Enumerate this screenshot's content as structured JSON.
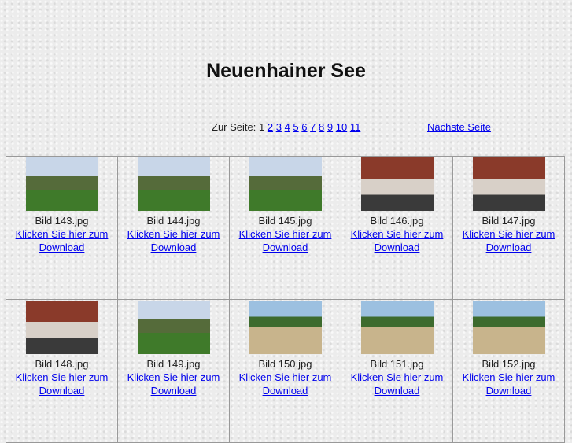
{
  "title": "Neuenhainer See",
  "pager": {
    "label": "Zur Seite:",
    "current": "1",
    "pages": [
      "2",
      "3",
      "4",
      "5",
      "6",
      "7",
      "8",
      "9",
      "10",
      "11"
    ],
    "next": "Nächste Seite"
  },
  "rows": [
    [
      {
        "name": "Bild 143.jpg",
        "type": "out"
      },
      {
        "name": "Bild 144.jpg",
        "type": "out"
      },
      {
        "name": "Bild 145.jpg",
        "type": "out"
      },
      {
        "name": "Bild 146.jpg",
        "type": "in"
      },
      {
        "name": "Bild 147.jpg",
        "type": "in"
      }
    ],
    [
      {
        "name": "Bild 148.jpg",
        "type": "in"
      },
      {
        "name": "Bild 149.jpg",
        "type": "out"
      },
      {
        "name": "Bild 150.jpg",
        "type": "sand"
      },
      {
        "name": "Bild 151.jpg",
        "type": "sand"
      },
      {
        "name": "Bild 152.jpg",
        "type": "sand"
      }
    ]
  ],
  "link_line1": "Klicken Sie hier zum",
  "link_line2": "Download"
}
